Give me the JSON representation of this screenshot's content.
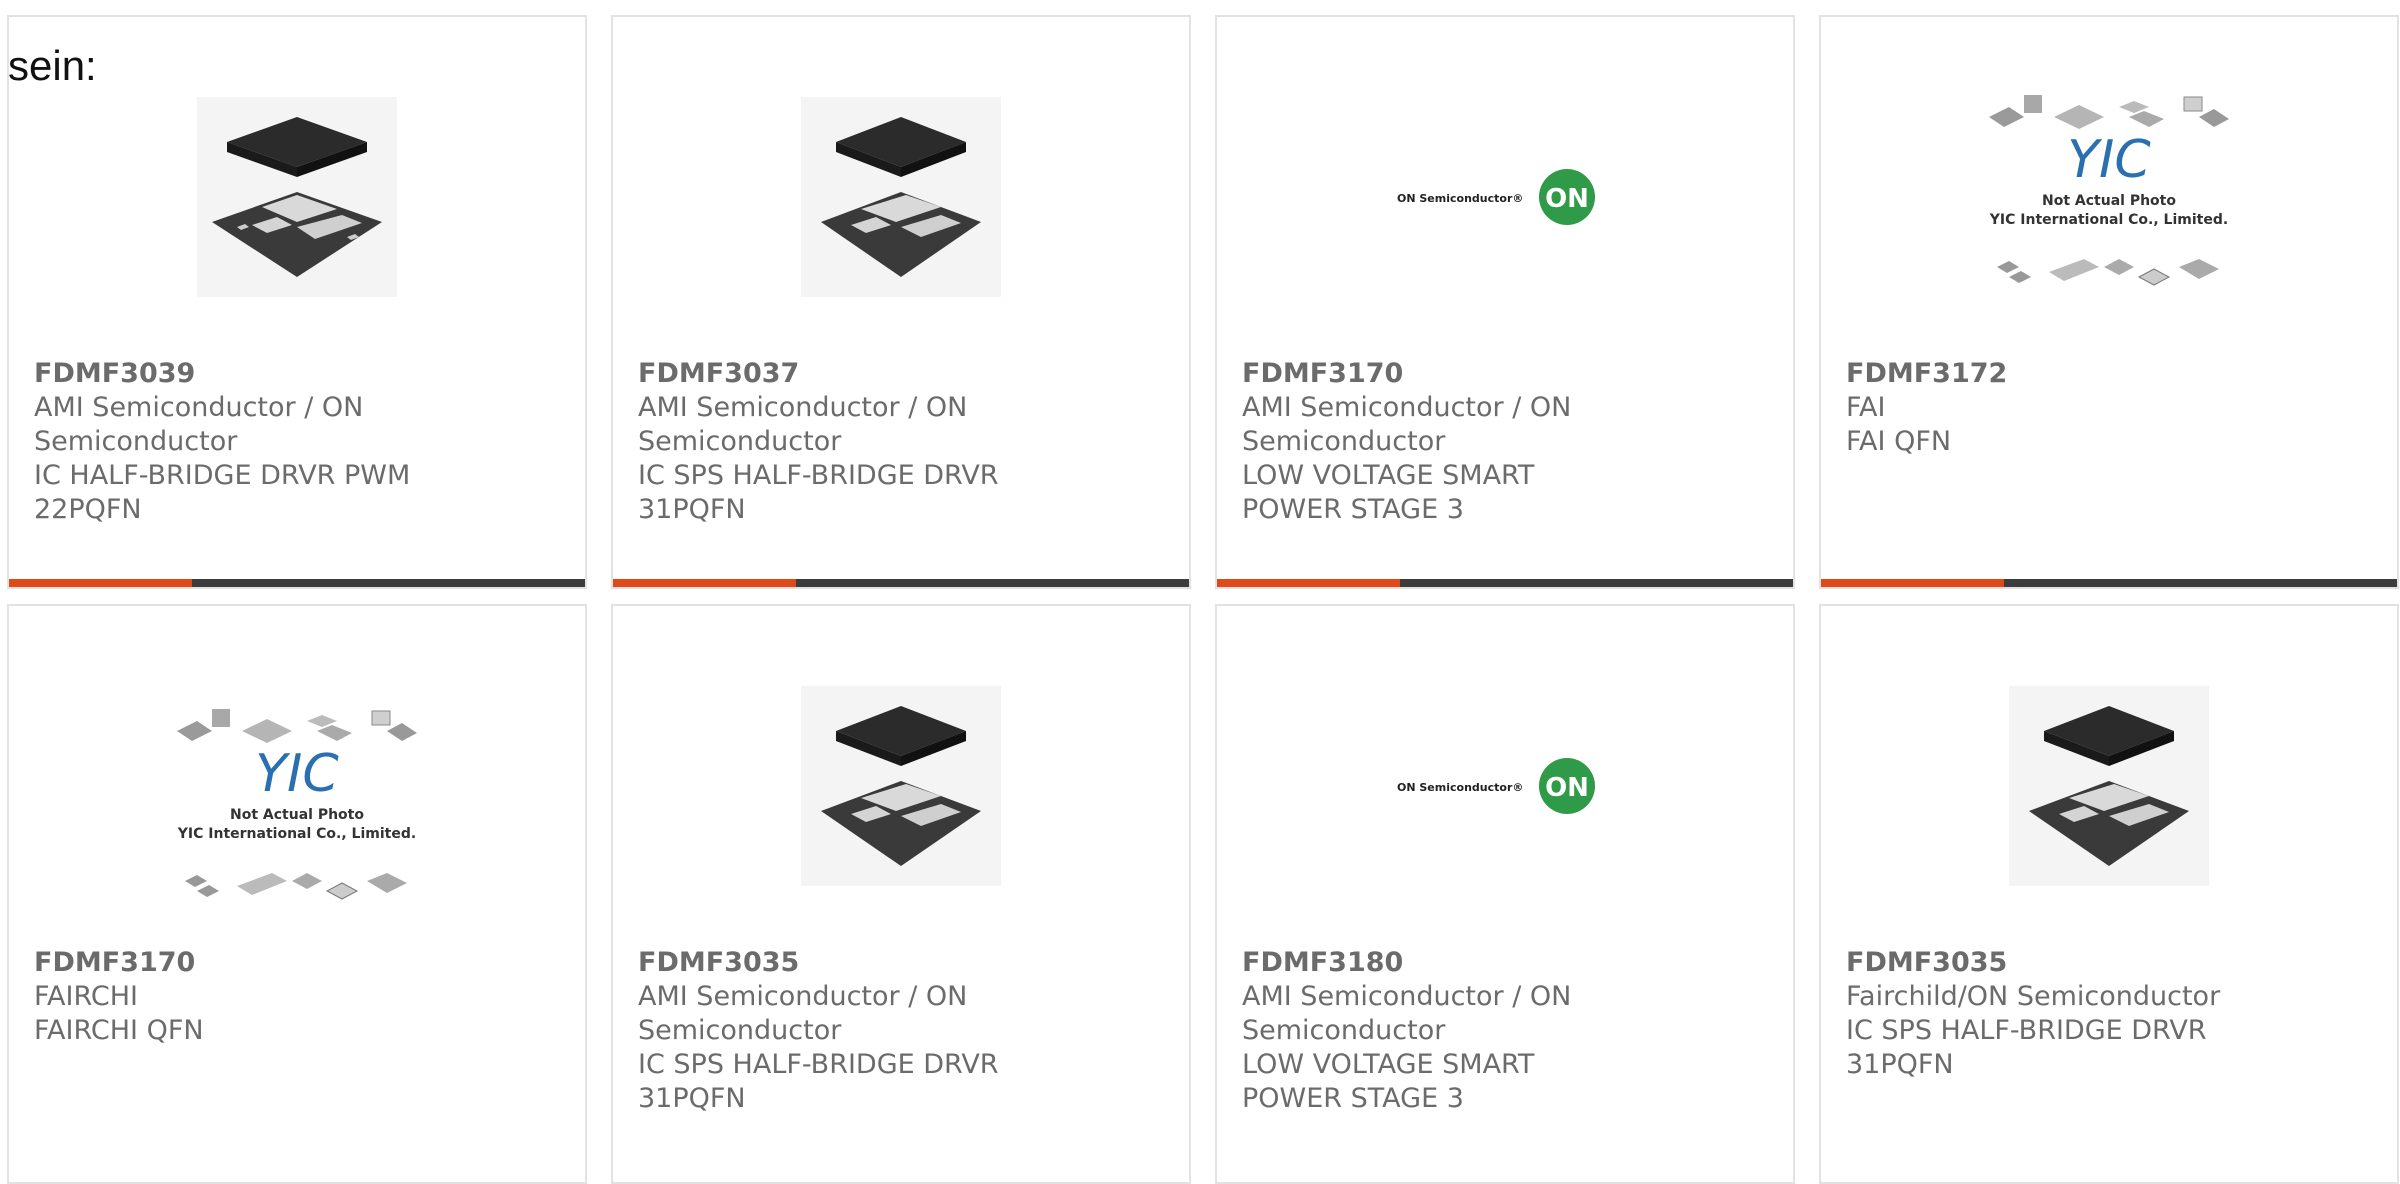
{
  "intro": "sein:",
  "colors": {
    "accent": "#e14918",
    "bar": "#3c3c3c",
    "text": "#6b6b6b",
    "on_logo": "#2f9a47"
  },
  "products": [
    {
      "part": "FDMF3039",
      "manufacturer": "AMI Semiconductor / ON Semiconductor",
      "description": "IC HALF-BRIDGE DRVR PWM 22PQFN",
      "image": "qfn-package-photo"
    },
    {
      "part": "FDMF3037",
      "manufacturer": "AMI Semiconductor / ON Semiconductor",
      "description": "IC SPS HALF-BRIDGE DRVR 31PQFN",
      "image": "qfn-package-photo"
    },
    {
      "part": "FDMF3170",
      "manufacturer": "AMI Semiconductor / ON Semiconductor",
      "description": "LOW VOLTAGE SMART POWER STAGE 3",
      "image": "on-semiconductor-logo"
    },
    {
      "part": "FDMF3172",
      "manufacturer": "FAI",
      "description": "FAI QFN",
      "image": "yic-placeholder"
    },
    {
      "part": "FDMF3170",
      "manufacturer": "FAIRCHI",
      "description": "FAIRCHI QFN",
      "image": "yic-placeholder"
    },
    {
      "part": "FDMF3035",
      "manufacturer": "AMI Semiconductor / ON Semiconductor",
      "description": "IC SPS HALF-BRIDGE DRVR 31PQFN",
      "image": "qfn-package-photo"
    },
    {
      "part": "FDMF3180",
      "manufacturer": "AMI Semiconductor / ON Semiconductor",
      "description": "LOW VOLTAGE SMART POWER STAGE 3",
      "image": "on-semiconductor-logo"
    },
    {
      "part": "FDMF3035",
      "manufacturer": "Fairchild/ON Semiconductor",
      "description": "IC SPS HALF-BRIDGE DRVR 31PQFN",
      "image": "qfn-package-photo"
    }
  ],
  "logos": {
    "on_wordmark": "ON Semiconductor®",
    "on_badge": "ON",
    "yic_mark": "YIC",
    "yic_line1": "Not Actual Photo",
    "yic_line2": "YIC International Co., Limited."
  }
}
